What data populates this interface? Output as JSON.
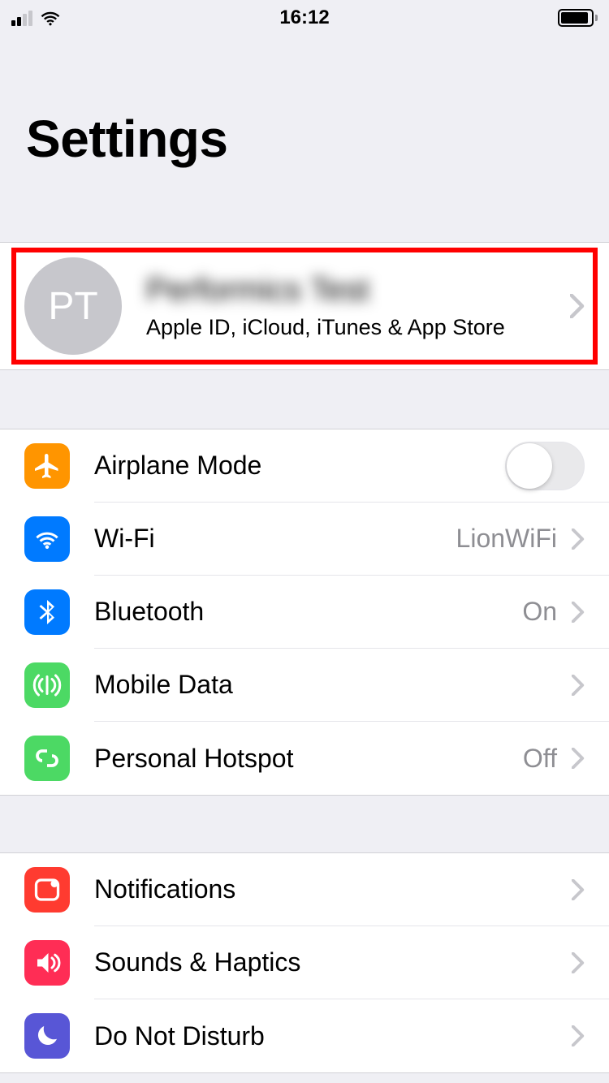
{
  "status_bar": {
    "time": "16:12"
  },
  "header": {
    "title": "Settings"
  },
  "profile": {
    "initials": "PT",
    "name": "Performics Test",
    "subtitle": "Apple ID, iCloud, iTunes & App Store"
  },
  "group1": {
    "airplane": {
      "label": "Airplane Mode"
    },
    "wifi": {
      "label": "Wi-Fi",
      "detail": "LionWiFi"
    },
    "bluetooth": {
      "label": "Bluetooth",
      "detail": "On"
    },
    "mobile_data": {
      "label": "Mobile Data"
    },
    "hotspot": {
      "label": "Personal Hotspot",
      "detail": "Off"
    }
  },
  "group2": {
    "notifications": {
      "label": "Notifications"
    },
    "sounds": {
      "label": "Sounds & Haptics"
    },
    "dnd": {
      "label": "Do Not Disturb"
    }
  }
}
